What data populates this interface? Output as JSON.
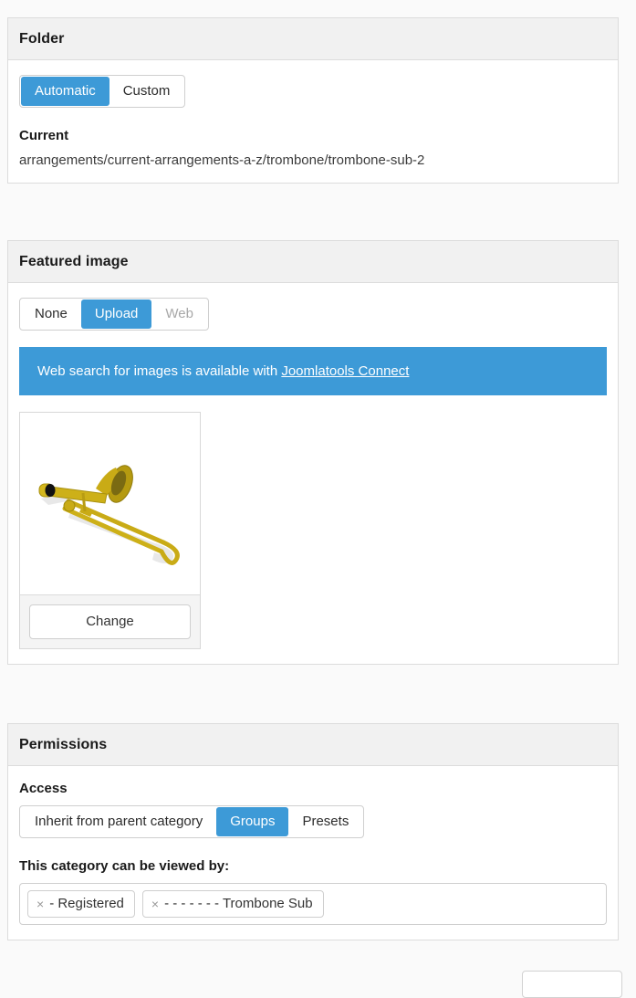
{
  "folder_panel": {
    "title": "Folder",
    "mode_toggle": {
      "name": "folder-mode",
      "options": [
        {
          "label": "Automatic",
          "active": true,
          "disabled": false
        },
        {
          "label": "Custom",
          "active": false,
          "disabled": false
        }
      ]
    },
    "current_label": "Current",
    "current_path": "arrangements/current-arrangements-a-z/trombone/trombone-sub-2"
  },
  "featured_panel": {
    "title": "Featured image",
    "source_toggle": {
      "name": "featured-image-source",
      "options": [
        {
          "label": "None",
          "active": false,
          "disabled": false
        },
        {
          "label": "Upload",
          "active": true,
          "disabled": false
        },
        {
          "label": "Web",
          "active": false,
          "disabled": true
        }
      ]
    },
    "banner": {
      "text_before": "Web search for images is available with ",
      "link_label": "Joomlatools Connect"
    },
    "thumbnail": {
      "alt": "trombone-image",
      "change_label": "Change"
    }
  },
  "permissions_panel": {
    "title": "Permissions",
    "access_label": "Access",
    "access_toggle": {
      "name": "access-mode",
      "options": [
        {
          "label": "Inherit from parent category",
          "active": false,
          "disabled": false
        },
        {
          "label": "Groups",
          "active": true,
          "disabled": false
        },
        {
          "label": "Presets",
          "active": false,
          "disabled": false
        }
      ]
    },
    "viewers_label": "This category can be viewed by:",
    "viewer_tags": [
      {
        "remove_icon": "×",
        "label": "- Registered"
      },
      {
        "remove_icon": "×",
        "label": "- - - - - - - Trombone Sub"
      }
    ]
  },
  "colors": {
    "accent_blue": "#3d9ad7",
    "panel_header_bg": "#f1f1f1",
    "page_bg": "#fafafa",
    "border": "#dcdcdc"
  }
}
